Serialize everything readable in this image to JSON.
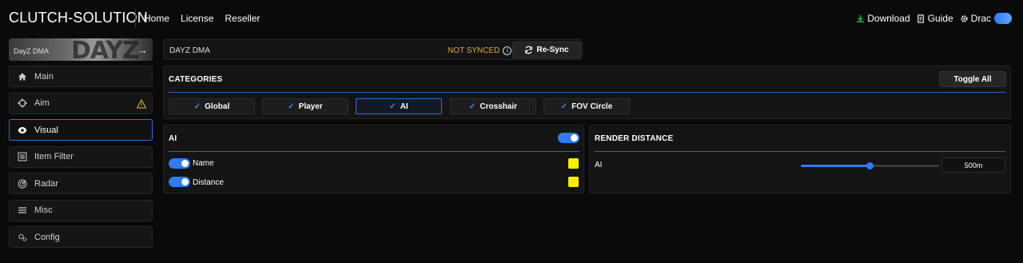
{
  "brand": "CLUTCH-SOLUTION",
  "nav": [
    "Home",
    "License",
    "Reseller"
  ],
  "top_right": {
    "download": "Download",
    "guide": "Guide",
    "user": "Drac"
  },
  "colors": {
    "accent": "#2f7bf0",
    "warning": "#e3a53a",
    "swatch": "#f6f000",
    "download_icon": "#2fb84a"
  },
  "sidebar": {
    "game_banner_label": "DayZ DMA",
    "game_banner_art_text": "DAYZ",
    "items": [
      {
        "label": "Main",
        "icon": "home-icon"
      },
      {
        "label": "Aim",
        "icon": "crosshair-icon",
        "warning": true
      },
      {
        "label": "Visual",
        "icon": "eye-icon",
        "active": true
      },
      {
        "label": "Item Filter",
        "icon": "list-icon"
      },
      {
        "label": "Radar",
        "icon": "radar-icon"
      },
      {
        "label": "Misc",
        "icon": "menu-icon"
      },
      {
        "label": "Config",
        "icon": "gears-icon"
      }
    ]
  },
  "game_panel": {
    "name": "DAYZ DMA",
    "status": "NOT SYNCED",
    "resync_label": "Re-Sync"
  },
  "categories": {
    "title": "CATEGORIES",
    "toggle_all": "Toggle All",
    "items": [
      "Global",
      "Player",
      "AI",
      "Crosshair",
      "FOV Circle"
    ],
    "active": "AI"
  },
  "ai_panel": {
    "title": "AI",
    "enabled": true,
    "rows": [
      {
        "label": "Name",
        "enabled": true
      },
      {
        "label": "Distance",
        "enabled": true
      }
    ]
  },
  "render_distance": {
    "title": "RENDER DISTANCE",
    "label": "AI",
    "value_text": "500m",
    "slider_fraction": 0.5
  }
}
